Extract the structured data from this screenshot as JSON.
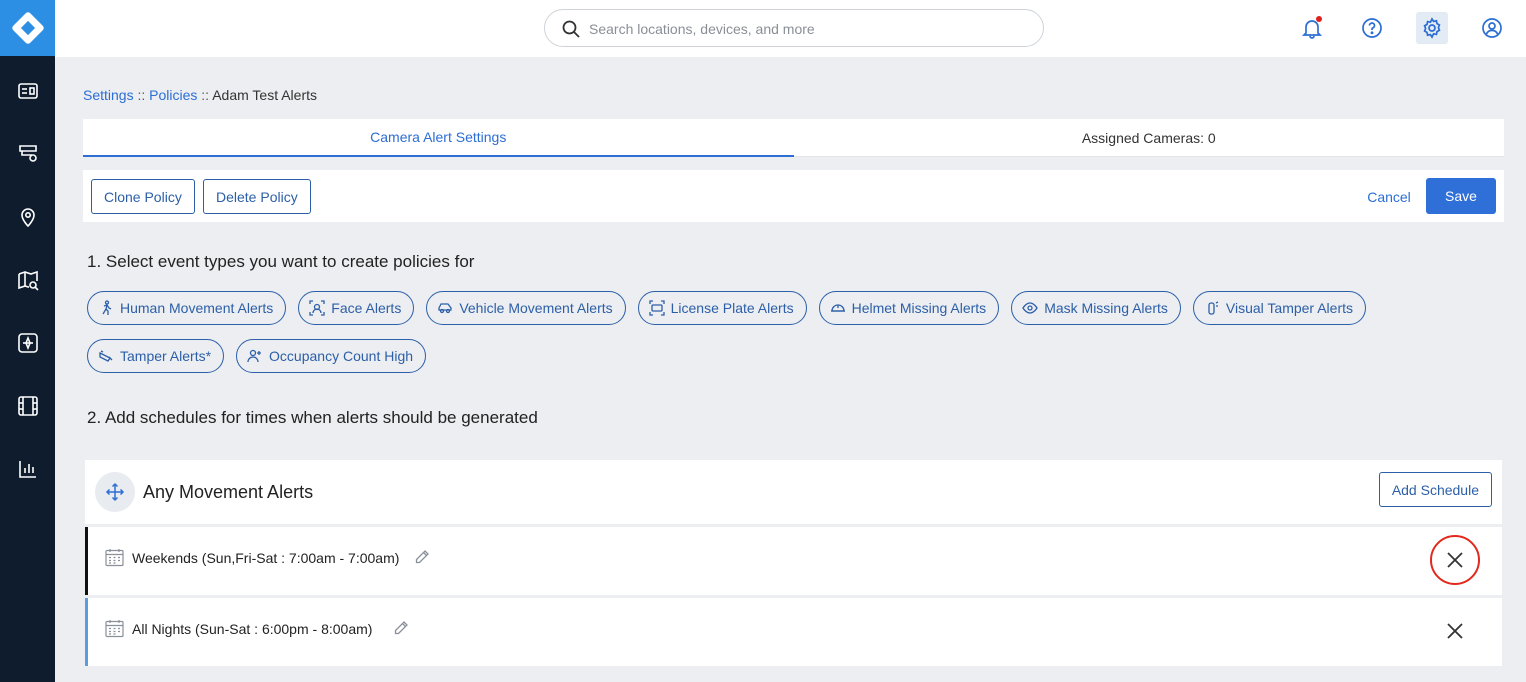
{
  "search": {
    "placeholder": "Search locations, devices, and more"
  },
  "icons": {
    "rail": [
      "dashboard-icon",
      "devices-icon",
      "location-pin-icon",
      "map-search-icon",
      "camera-view-icon",
      "film-icon",
      "analytics-icon"
    ],
    "top": [
      "bell-icon",
      "help-icon",
      "gear-icon",
      "user-icon"
    ]
  },
  "breadcrumb": {
    "settings": "Settings",
    "policies": "Policies",
    "separator": "::",
    "current": "Adam Test Alerts"
  },
  "tabs": [
    {
      "label": "Camera Alert Settings",
      "active": true
    },
    {
      "label": "Assigned Cameras: 0",
      "active": false
    }
  ],
  "toolbar": {
    "clone": "Clone Policy",
    "delete": "Delete Policy",
    "cancel": "Cancel",
    "save": "Save"
  },
  "section1": {
    "title": "1. Select event types you want to create policies for"
  },
  "events": [
    {
      "label": "Human Movement Alerts",
      "icon": "running-person-icon"
    },
    {
      "label": "Face Alerts",
      "icon": "face-scan-icon"
    },
    {
      "label": "Vehicle Movement Alerts",
      "icon": "car-icon"
    },
    {
      "label": "License Plate Alerts",
      "icon": "license-plate-icon"
    },
    {
      "label": "Helmet Missing Alerts",
      "icon": "helmet-icon"
    },
    {
      "label": "Mask Missing Alerts",
      "icon": "eye-icon"
    },
    {
      "label": "Visual Tamper Alerts",
      "icon": "camera-tamper-icon"
    },
    {
      "label": "Tamper Alerts*",
      "icon": "tamper-icon"
    },
    {
      "label": "Occupancy Count High",
      "icon": "person-add-icon"
    }
  ],
  "section2": {
    "title": "2. Add schedules for times when alerts should be generated"
  },
  "schedule_card": {
    "title": "Any Movement Alerts",
    "add_label": "Add Schedule"
  },
  "schedules": [
    {
      "label": "Weekends (Sun,Fri-Sat : 7:00am - 7:00am)",
      "accent": "#111111"
    },
    {
      "label": "All Nights (Sun-Sat : 6:00pm - 8:00am)",
      "accent": "#5b9ee0"
    }
  ],
  "colors": {
    "brand": "#2d8fe4",
    "rail": "#0f1c2e",
    "primary": "#2e6fd8",
    "highlight_ring": "#e02a1e"
  }
}
